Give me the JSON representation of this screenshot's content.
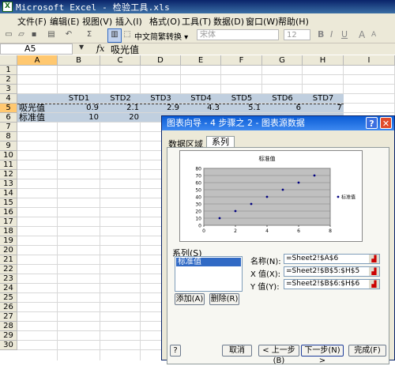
{
  "window": {
    "title": "Microsoft Excel - 检验工具.xls",
    "app_icon": "excel-icon"
  },
  "menu": [
    "文件(F)",
    "编辑(E)",
    "视图(V)",
    "插入(I)",
    "格式(O)",
    "工具(T)",
    "数据(D)",
    "窗口(W)",
    "帮助(H)"
  ],
  "toolbar": {
    "conversion_label": "中文简繁转换 ▾",
    "font": "宋体",
    "font_size": "12",
    "formatting": [
      "B",
      "I",
      "U",
      "A",
      "A"
    ]
  },
  "formula_bar": {
    "name_box": "A5",
    "fx": "fx",
    "content": "吸光值"
  },
  "grid": {
    "columns": [
      "A",
      "B",
      "C",
      "D",
      "E",
      "F",
      "G",
      "H",
      "I"
    ],
    "rows": [
      "1",
      "2",
      "3",
      "4",
      "5",
      "6",
      "7",
      "8",
      "9",
      "10",
      "11",
      "12",
      "13",
      "14",
      "15",
      "16",
      "17",
      "18",
      "19",
      "20",
      "21",
      "22",
      "23",
      "24",
      "25",
      "26",
      "27",
      "28",
      "29",
      "30"
    ],
    "row4": [
      "",
      "STD1",
      "STD2",
      "STD3",
      "STD4",
      "STD5",
      "STD6",
      "STD7"
    ],
    "row5": [
      "吸光值",
      "0.9",
      "2.1",
      "2.9",
      "4.3",
      "5.1",
      "6",
      "7"
    ],
    "row6": [
      "标准值",
      "10",
      "20"
    ]
  },
  "dialog": {
    "title": "图表向导 - 4 步骤之 2 - 图表源数据",
    "help_button": "?",
    "close_button": "✕",
    "tabs": [
      "数据区域",
      "系列"
    ],
    "active_tab": "系列",
    "series_label": "系列(S)",
    "series_items": [
      "标准值"
    ],
    "add_button": "添加(A)",
    "remove_button": "删除(R)",
    "fields": {
      "name_label": "名称(N):",
      "name_value": "=Sheet2!$A$6",
      "x_label": "X 值(X):",
      "x_value": "=Sheet2!$B$5:$H$5",
      "y_label": "Y 值(Y):",
      "y_value": "=Sheet2!$B$6:$H$6"
    },
    "buttons": {
      "help": "?",
      "cancel": "取消",
      "back": "< 上一步(B)",
      "next": "下一步(N) >",
      "finish": "完成(F)"
    }
  },
  "chart_data": {
    "type": "scatter",
    "title": "标准值",
    "x": [
      1,
      2,
      3,
      4,
      5,
      6,
      7
    ],
    "series": [
      {
        "name": "标准值",
        "values": [
          10,
          20,
          30,
          40,
          50,
          60,
          70
        ]
      }
    ],
    "xlim": [
      0,
      8
    ],
    "ylim": [
      0,
      80
    ],
    "x_ticks": [
      0,
      2,
      4,
      6,
      8
    ],
    "y_ticks": [
      0,
      10,
      20,
      30,
      40,
      50,
      60,
      70,
      80
    ],
    "grid": "horizontal",
    "legend": "right",
    "colors": {
      "point": "#000080",
      "plot_bg": "#c0c0c0"
    }
  }
}
